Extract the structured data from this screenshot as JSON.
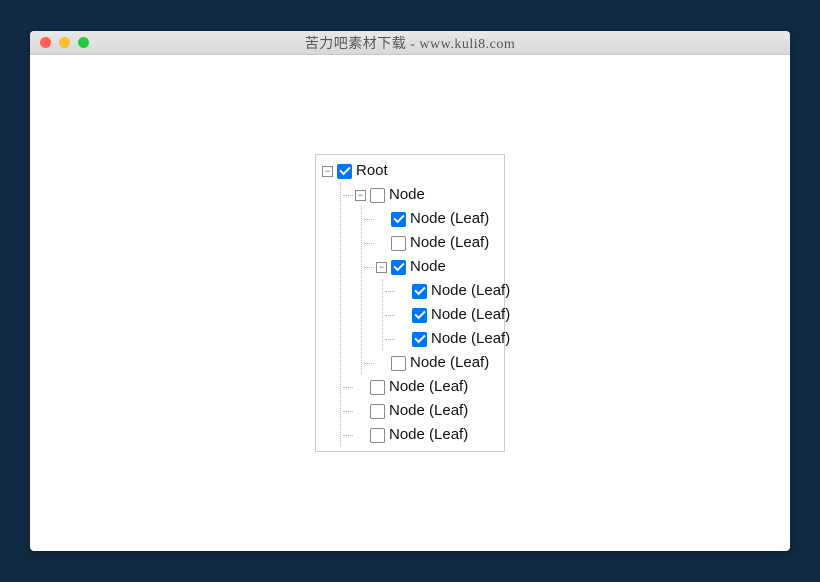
{
  "window": {
    "title": "苦力吧素材下载 - www.kuli8.com"
  },
  "tree": {
    "label": "Root",
    "checked": true,
    "expanded": true,
    "children": [
      {
        "label": "Node",
        "checked": false,
        "expanded": true,
        "children": [
          {
            "label": "Node (Leaf)",
            "checked": true
          },
          {
            "label": "Node (Leaf)",
            "checked": false
          },
          {
            "label": "Node",
            "checked": true,
            "expanded": true,
            "children": [
              {
                "label": "Node (Leaf)",
                "checked": true
              },
              {
                "label": "Node (Leaf)",
                "checked": true
              },
              {
                "label": "Node (Leaf)",
                "checked": true
              }
            ]
          },
          {
            "label": "Node (Leaf)",
            "checked": false
          }
        ]
      },
      {
        "label": "Node (Leaf)",
        "checked": false
      },
      {
        "label": "Node (Leaf)",
        "checked": false
      },
      {
        "label": "Node (Leaf)",
        "checked": false
      }
    ]
  }
}
